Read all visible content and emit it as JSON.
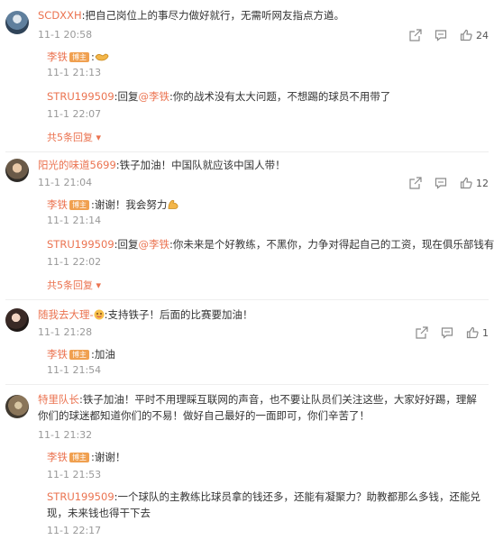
{
  "comments": [
    {
      "user": "SCDXXH",
      "text": ":把自己岗位上的事尽力做好就行，无需听网友指点方遒。",
      "time": "11-1 20:58",
      "likes": "24",
      "replies": [
        {
          "user": "李铁",
          "badge": "博主",
          "text": ":",
          "time": "11-1 21:13"
        },
        {
          "user": "STRU199509",
          "prefix": ":回复",
          "mention": "@李铁",
          "text": ":你的战术没有太大问题，不想踢的球员不用带了",
          "time": "11-1 22:07"
        }
      ],
      "more": "共5条回复"
    },
    {
      "user": "阳光的味道5699",
      "text": ":铁子加油！中国队就应该中国人带！",
      "time": "11-1 21:04",
      "likes": "12",
      "replies": [
        {
          "user": "李铁",
          "badge": "博主",
          "text": ":谢谢！我会努力",
          "time": "11-1 21:14"
        },
        {
          "user": "STRU199509",
          "prefix": ":回复",
          "mention": "@李铁",
          "text": ":你未来是个好教练，不黑你，力争对得起自己的工资，现在俱乐部钱有限！",
          "time": "11-1 22:02"
        }
      ],
      "more": "共5条回复"
    },
    {
      "user": "随我去大理-",
      "text": ":支持铁子！后面的比赛要加油！",
      "time": "11-1 21:28",
      "likes": "1",
      "replies": [
        {
          "user": "李铁",
          "badge": "博主",
          "text": ":加油",
          "time": "11-1 21:54"
        }
      ]
    },
    {
      "user": "特里队长",
      "text": ":铁子加油！平时不用理睬互联网的声音，也不要让队员们关注这些，大家好好踢，理解你们的球迷都知道你们的不易！做好自己最好的一面即可，你们辛苦了！",
      "time": "11-1 21:32",
      "replies": [
        {
          "user": "李铁",
          "badge": "博主",
          "text": ":谢谢！",
          "time": "11-1 21:53"
        },
        {
          "user": "STRU199509",
          "text": ":一个球队的主教练比球员拿的钱还多，还能有凝聚力？助教都那么多钱，还能兑现，未来钱也得干下去",
          "time": "11-1 22:17"
        }
      ]
    }
  ]
}
